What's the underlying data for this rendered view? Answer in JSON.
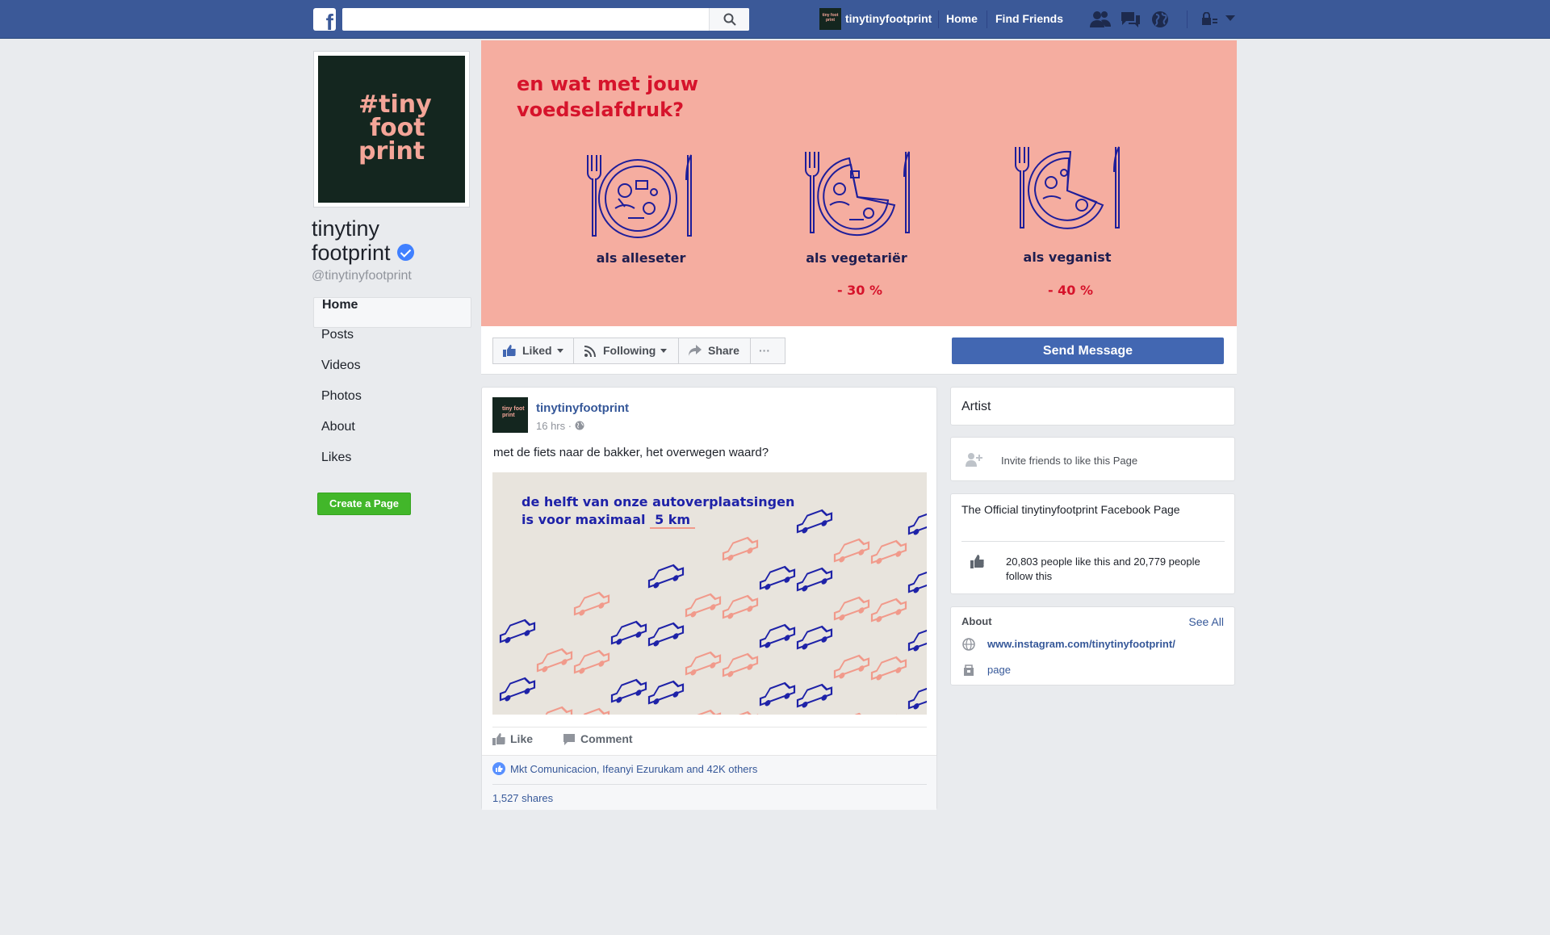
{
  "topbar": {
    "logo": "f",
    "search_placeholder": "",
    "profile_name": "tinytinyfootprint",
    "avatar_text": "tiny foot print",
    "home": "Home",
    "find_friends": "Find Friends",
    "icons": [
      "friend-requests-icon",
      "messages-icon",
      "notifications-globe-icon",
      "privacy-lock-icon",
      "account-menu-caret-icon"
    ],
    "bar_color": "#3b5998"
  },
  "page": {
    "name_line1": "tinytiny",
    "name_line2": "footprint",
    "handle": "@tinytinyfootprint",
    "logo_lines": [
      "#tiny",
      "foot",
      "print"
    ]
  },
  "sidebar": {
    "items": [
      {
        "label": "Home",
        "active": true
      },
      {
        "label": "Posts"
      },
      {
        "label": "Videos"
      },
      {
        "label": "Photos"
      },
      {
        "label": "About"
      },
      {
        "label": "Likes"
      }
    ],
    "create_page": "Create a Page"
  },
  "cover": {
    "title_line1": "en wat met jouw",
    "title_line2": "voedselafdruk?",
    "plates": [
      {
        "label": "als alleseter",
        "pct": ""
      },
      {
        "label": "als vegetariër",
        "pct": "- 30 %"
      },
      {
        "label": "als veganist",
        "pct": "- 40 %"
      }
    ],
    "bg_color": "#f5ada0",
    "accent_color": "#d6132b"
  },
  "actions": {
    "liked": "Liked",
    "following": "Following",
    "share": "Share",
    "more": "···",
    "send_message": "Send Message"
  },
  "post": {
    "author": "tinytinyfootprint",
    "time": "16 hrs · ",
    "text": "met de fiets naar de bakker, het overwegen waard?",
    "image_line1": "de helft van onze autoverplaatsingen",
    "image_line2": "is voor maximaal",
    "image_km": "5  km",
    "like": "Like",
    "comment": "Comment",
    "likes_text": "Mkt Comunicacion, Ifeanyi Ezurukam and 42K others",
    "shares": "1,527 shares"
  },
  "right": {
    "category": "Artist",
    "invite": "Invite friends to like this Page",
    "official_title": "The Official tinytinyfootprint Facebook Page",
    "stats": "20,803 people like this and 20,779 people follow this",
    "about_title": "About",
    "see_all": "See All",
    "instagram": "www.instagram.com/tinytinyfootprint/",
    "page_label": "page"
  }
}
